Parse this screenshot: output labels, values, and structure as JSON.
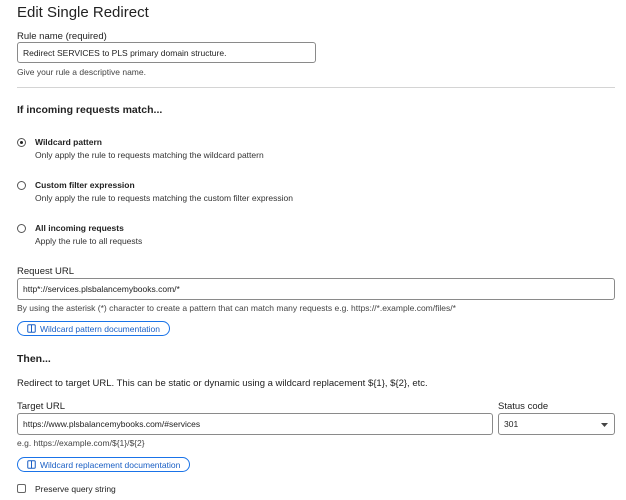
{
  "title": "Edit Single Redirect",
  "rule_name": {
    "label": "Rule name (required)",
    "value": "Redirect SERVICES to PLS primary domain structure.",
    "help": "Give your rule a descriptive name."
  },
  "match": {
    "heading": "If incoming requests match...",
    "options": [
      {
        "title": "Wildcard pattern",
        "desc": "Only apply the rule to requests matching the wildcard pattern",
        "checked": true
      },
      {
        "title": "Custom filter expression",
        "desc": "Only apply the rule to requests matching the custom filter expression",
        "checked": false
      },
      {
        "title": "All incoming requests",
        "desc": "Apply the rule to all requests",
        "checked": false
      }
    ]
  },
  "request_url": {
    "label": "Request URL",
    "value": "http*://services.plsbalancemybooks.com/*",
    "help": "By using the asterisk (*) character to create a pattern that can match many requests e.g. https://*.example.com/files/*",
    "doc_link": "Wildcard pattern documentation"
  },
  "then": {
    "heading": "Then...",
    "desc": "Redirect to target URL. This can be static or dynamic using a wildcard replacement ${1}, ${2}, etc."
  },
  "target_url": {
    "label": "Target URL",
    "value": "https://www.plsbalancemybooks.com/#services",
    "help": "e.g. https://example.com/${1}/${2}",
    "doc_link": "Wildcard replacement documentation"
  },
  "status_code": {
    "label": "Status code",
    "value": "301"
  },
  "preserve_query": {
    "label": "Preserve query string",
    "checked": false
  },
  "colors": {
    "link": "#1a5fc4",
    "link_border": "#1a73e8"
  }
}
